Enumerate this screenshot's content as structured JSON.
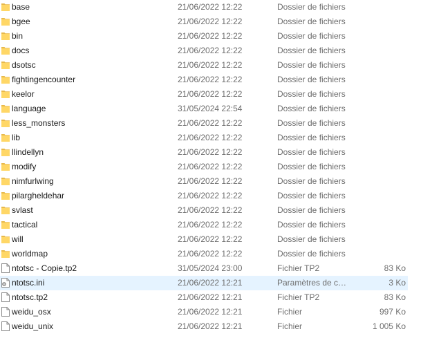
{
  "colors": {
    "folder": "#ffd766",
    "folder_dark": "#e8b94a",
    "selected_bg": "#e5f3ff",
    "secondary_text": "#6d6d6d"
  },
  "items": [
    {
      "name": "base",
      "date": "21/06/2022 12:22",
      "type": "Dossier de fichiers",
      "size": "",
      "icon": "folder-icon"
    },
    {
      "name": "bgee",
      "date": "21/06/2022 12:22",
      "type": "Dossier de fichiers",
      "size": "",
      "icon": "folder-icon"
    },
    {
      "name": "bin",
      "date": "21/06/2022 12:22",
      "type": "Dossier de fichiers",
      "size": "",
      "icon": "folder-icon"
    },
    {
      "name": "docs",
      "date": "21/06/2022 12:22",
      "type": "Dossier de fichiers",
      "size": "",
      "icon": "folder-icon"
    },
    {
      "name": "dsotsc",
      "date": "21/06/2022 12:22",
      "type": "Dossier de fichiers",
      "size": "",
      "icon": "folder-icon"
    },
    {
      "name": "fightingencounter",
      "date": "21/06/2022 12:22",
      "type": "Dossier de fichiers",
      "size": "",
      "icon": "folder-icon"
    },
    {
      "name": "keelor",
      "date": "21/06/2022 12:22",
      "type": "Dossier de fichiers",
      "size": "",
      "icon": "folder-icon"
    },
    {
      "name": "language",
      "date": "31/05/2024 22:54",
      "type": "Dossier de fichiers",
      "size": "",
      "icon": "folder-icon"
    },
    {
      "name": "less_monsters",
      "date": "21/06/2022 12:22",
      "type": "Dossier de fichiers",
      "size": "",
      "icon": "folder-icon"
    },
    {
      "name": "lib",
      "date": "21/06/2022 12:22",
      "type": "Dossier de fichiers",
      "size": "",
      "icon": "folder-icon"
    },
    {
      "name": "llindellyn",
      "date": "21/06/2022 12:22",
      "type": "Dossier de fichiers",
      "size": "",
      "icon": "folder-icon"
    },
    {
      "name": "modify",
      "date": "21/06/2022 12:22",
      "type": "Dossier de fichiers",
      "size": "",
      "icon": "folder-icon"
    },
    {
      "name": "nimfurlwing",
      "date": "21/06/2022 12:22",
      "type": "Dossier de fichiers",
      "size": "",
      "icon": "folder-icon"
    },
    {
      "name": "pilargheldehar",
      "date": "21/06/2022 12:22",
      "type": "Dossier de fichiers",
      "size": "",
      "icon": "folder-icon"
    },
    {
      "name": "svlast",
      "date": "21/06/2022 12:22",
      "type": "Dossier de fichiers",
      "size": "",
      "icon": "folder-icon"
    },
    {
      "name": "tactical",
      "date": "21/06/2022 12:22",
      "type": "Dossier de fichiers",
      "size": "",
      "icon": "folder-icon"
    },
    {
      "name": "will",
      "date": "21/06/2022 12:22",
      "type": "Dossier de fichiers",
      "size": "",
      "icon": "folder-icon"
    },
    {
      "name": "worldmap",
      "date": "21/06/2022 12:22",
      "type": "Dossier de fichiers",
      "size": "",
      "icon": "folder-icon"
    },
    {
      "name": "ntotsc - Copie.tp2",
      "date": "31/05/2024 23:00",
      "type": "Fichier TP2",
      "size": "83 Ko",
      "icon": "file-icon"
    },
    {
      "name": "ntotsc.ini",
      "date": "21/06/2022 12:21",
      "type": "Paramètres de co...",
      "size": "3 Ko",
      "icon": "settings-file-icon",
      "selected": true
    },
    {
      "name": "ntotsc.tp2",
      "date": "21/06/2022 12:21",
      "type": "Fichier TP2",
      "size": "83 Ko",
      "icon": "file-icon"
    },
    {
      "name": "weidu_osx",
      "date": "21/06/2022 12:21",
      "type": "Fichier",
      "size": "997 Ko",
      "icon": "file-icon"
    },
    {
      "name": "weidu_unix",
      "date": "21/06/2022 12:21",
      "type": "Fichier",
      "size": "1 005 Ko",
      "icon": "file-icon"
    }
  ]
}
